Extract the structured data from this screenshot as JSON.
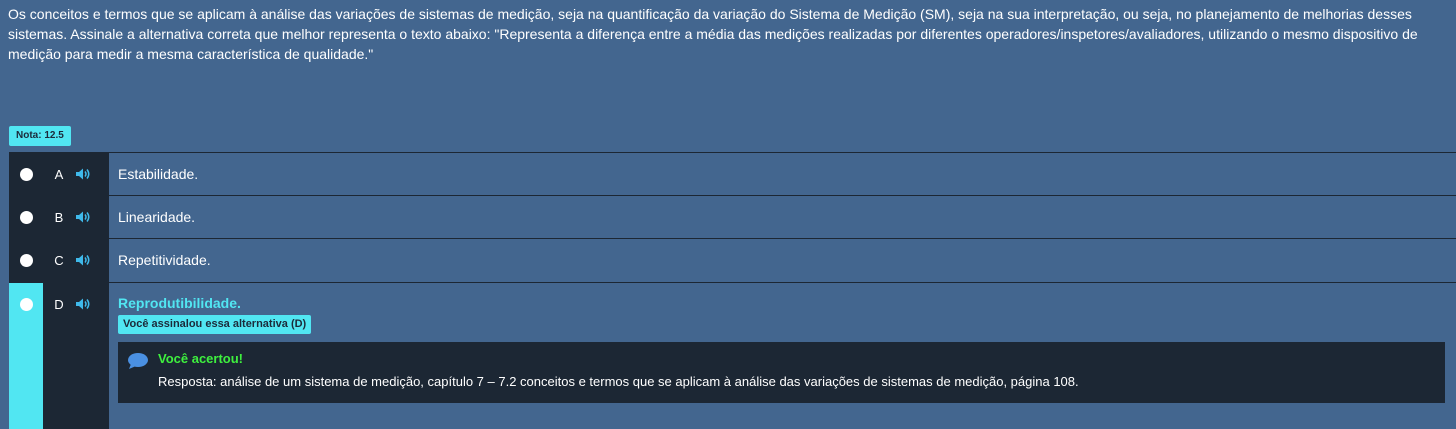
{
  "question": {
    "text": "Os conceitos e termos que se aplicam à análise das variações de sistemas de medição, seja na quantificação da variação do Sistema de Medição (SM), seja na sua interpretação, ou seja, no planejamento de melhorias desses sistemas. Assinale a alternativa correta que melhor representa o texto abaixo: \"Representa a diferença entre a média das medições realizadas por diferentes operadores/inspetores/avaliadores, utilizando o mesmo dispositivo de medição para medir a mesma característica de qualidade.\""
  },
  "score": {
    "label": "Nota: 12.5"
  },
  "options": [
    {
      "letter": "A",
      "label": "Estabilidade.",
      "icon": "speaker-icon"
    },
    {
      "letter": "B",
      "label": "Linearidade.",
      "icon": "speaker-icon"
    },
    {
      "letter": "C",
      "label": "Repetitividade.",
      "icon": "speaker-icon"
    },
    {
      "letter": "D",
      "label": "Reprodutibilidade.",
      "icon": "speaker-icon",
      "selected": true,
      "chosen_tag": "Você assinalou essa alternativa (D)"
    }
  ],
  "feedback": {
    "icon": "chat-bubble-icon",
    "title": "Você acertou!",
    "text": "Resposta: análise de um sistema de medição, capítulo 7 – 7.2 conceitos e termos que se aplicam à análise das variações de sistemas de medição, página 108."
  },
  "colors": {
    "background": "#43668f",
    "dark_panel": "#1c2734",
    "accent_cyan": "#51e6f2",
    "success_green": "#3ef03e"
  }
}
